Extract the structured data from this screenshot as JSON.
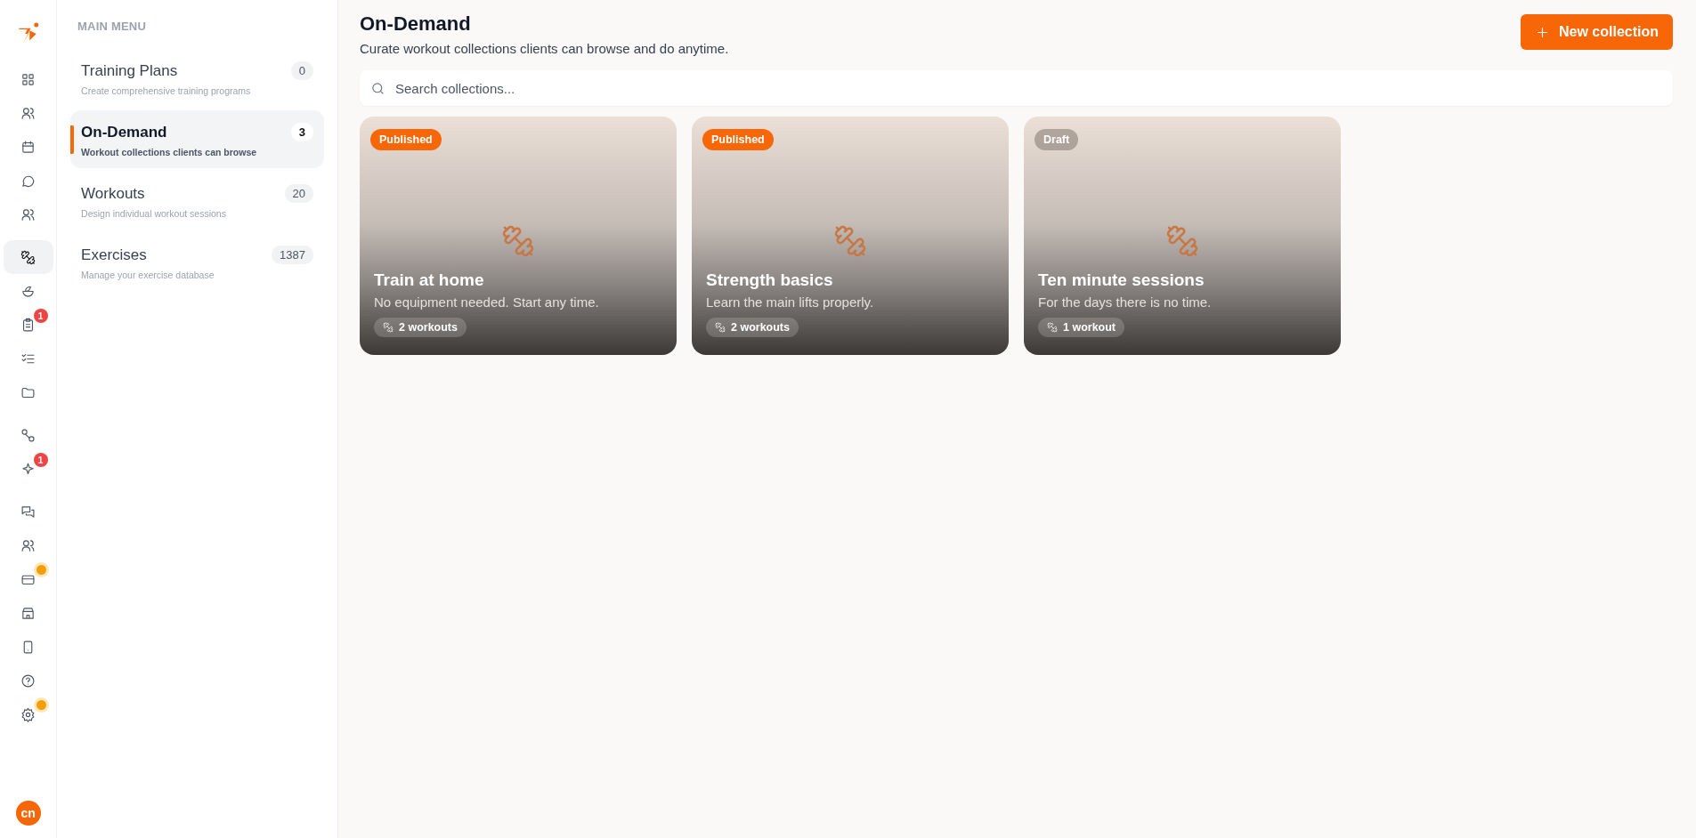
{
  "rail": {
    "avatar": "cn",
    "groups": [
      {
        "items": [
          {
            "selected": false
          },
          {
            "selected": false
          },
          {
            "selected": false
          },
          {
            "selected": false
          },
          {
            "selected": false
          }
        ]
      },
      {
        "items": [
          {
            "selected": true
          },
          {
            "selected": false
          },
          {
            "selected": false,
            "badge": "1"
          },
          {
            "selected": false
          },
          {
            "selected": false
          }
        ]
      },
      {
        "items": [
          {
            "selected": false
          },
          {
            "selected": false,
            "badge": "1"
          }
        ]
      },
      {
        "items": [
          {
            "selected": false
          },
          {
            "selected": false
          },
          {
            "selected": false,
            "alert": true
          },
          {
            "selected": false
          },
          {
            "selected": false
          },
          {
            "selected": false
          },
          {
            "selected": false,
            "alert": true
          }
        ]
      }
    ]
  },
  "sidebar": {
    "heading": "MAIN MENU",
    "items": [
      {
        "title": "Training Plans",
        "subtitle": "Create comprehensive training programs",
        "count": "0",
        "selected": false
      },
      {
        "title": "On-Demand",
        "subtitle": "Workout collections clients can browse",
        "count": "3",
        "selected": true
      },
      {
        "title": "Workouts",
        "subtitle": "Design individual workout sessions",
        "count": "20",
        "selected": false
      },
      {
        "title": "Exercises",
        "subtitle": "Manage your exercise database",
        "count": "1387",
        "selected": false
      }
    ]
  },
  "header": {
    "title": "On-Demand",
    "subtitle": "Curate workout collections clients can browse and do anytime.",
    "button": "New collection"
  },
  "search": {
    "placeholder": "Search collections..."
  },
  "collections": [
    {
      "status": "Published",
      "kind": "published",
      "title": "Train at home",
      "description": "No equipment needed. Start any time.",
      "workouts": "2 workouts"
    },
    {
      "status": "Published",
      "kind": "published",
      "title": "Strength basics",
      "description": "Learn the main lifts properly.",
      "workouts": "2 workouts"
    },
    {
      "status": "Draft",
      "kind": "draft",
      "title": "Ten minute sessions",
      "description": "For the days there is no time.",
      "workouts": "1 workout"
    }
  ]
}
